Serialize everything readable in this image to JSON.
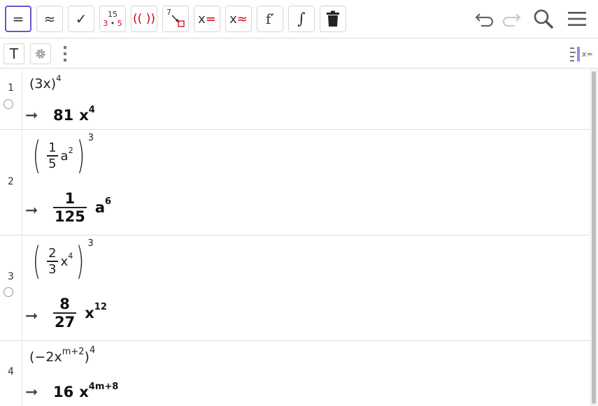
{
  "toolbar": {
    "buttons": [
      {
        "name": "evaluate-button",
        "label": "="
      },
      {
        "name": "numeric-button",
        "label": "≈"
      },
      {
        "name": "keep-input-button",
        "label": "✓"
      },
      {
        "name": "factor-button",
        "top": "15",
        "bottom_a": "3",
        "dot": "•",
        "bottom_b": "5"
      },
      {
        "name": "expand-button",
        "label": "(( ))"
      },
      {
        "name": "substitute-button",
        "top": "7"
      },
      {
        "name": "solve-button",
        "x": "x",
        "eq": "="
      },
      {
        "name": "nsolve-button",
        "x": "x",
        "eq": "≈"
      },
      {
        "name": "derivative-button",
        "label": "f′"
      },
      {
        "name": "integral-button",
        "label": "∫"
      }
    ],
    "right_icons": [
      "undo-icon",
      "redo-icon",
      "search-icon",
      "menu-icon"
    ]
  },
  "subbar": {
    "text_button": "T",
    "algebra_toggle_label": "x="
  },
  "rows": [
    {
      "n": "1",
      "input_base": "(3x)",
      "input_exp": "4",
      "output_coef": "81",
      "output_var": "x",
      "output_exp": "4"
    },
    {
      "n": "2",
      "input_num": "1",
      "input_den": "5",
      "input_var": "a",
      "input_var_exp": "2",
      "input_exp": "3",
      "output_num": "1",
      "output_den": "125",
      "output_var": "a",
      "output_exp": "6"
    },
    {
      "n": "3",
      "input_num": "2",
      "input_den": "3",
      "input_var": "x",
      "input_var_exp": "4",
      "input_exp": "3",
      "output_num": "8",
      "output_den": "27",
      "output_var": "x",
      "output_exp": "12"
    },
    {
      "n": "4",
      "input_open": "(",
      "input_coef": "−2x",
      "input_var_exp": "m+2",
      "input_close": ")",
      "input_exp": "4",
      "output_coef": "16",
      "output_var": "x",
      "output_exp": "4m+8"
    }
  ],
  "arrow_symbol": "➞"
}
